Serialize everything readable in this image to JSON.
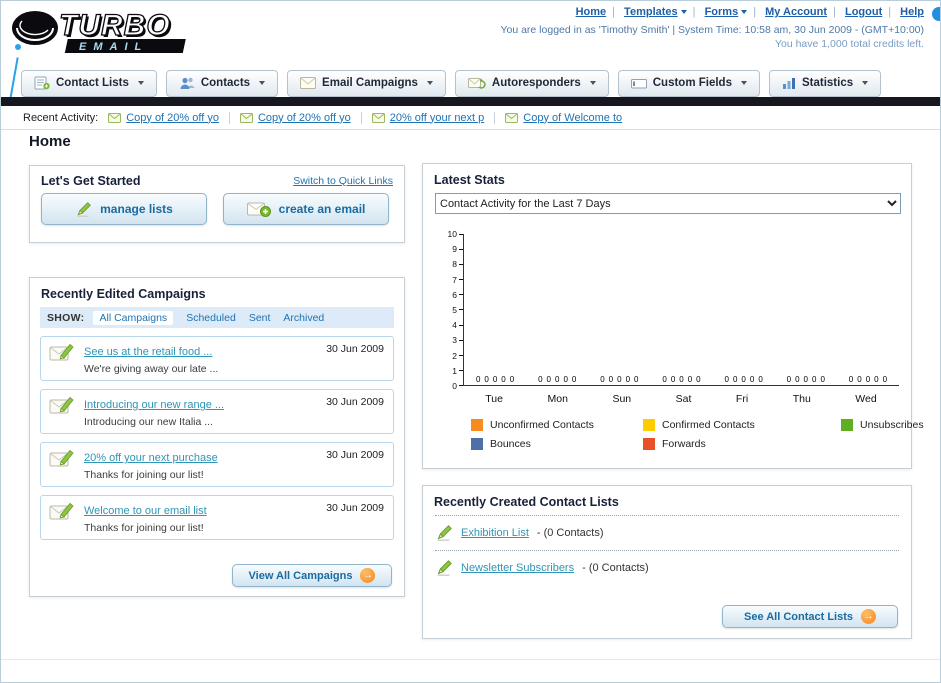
{
  "header": {
    "logo_text": "TURBO",
    "logo_sub": "EMAIL",
    "links": [
      {
        "label": "Home",
        "dropdown": false
      },
      {
        "label": "Templates",
        "dropdown": true
      },
      {
        "label": "Forms",
        "dropdown": true
      },
      {
        "label": "My Account",
        "dropdown": false
      },
      {
        "label": "Logout",
        "dropdown": false
      },
      {
        "label": "Help",
        "dropdown": false
      }
    ],
    "status_line1": "You are logged in as 'Timothy Smith' | System Time: 10:58 am, 30 Jun 2009 - (GMT+10:00)",
    "status_line2": "You have 1,000 total credits left."
  },
  "nav": {
    "items": [
      {
        "label": "Contact Lists"
      },
      {
        "label": "Contacts"
      },
      {
        "label": "Email Campaigns"
      },
      {
        "label": "Autoresponders"
      },
      {
        "label": "Custom Fields"
      },
      {
        "label": "Statistics"
      }
    ]
  },
  "activity": {
    "label": "Recent Activity:",
    "items": [
      "Copy of 20% off yo",
      "Copy of 20% off yo",
      "20% off your next p",
      "Copy of Welcome to"
    ]
  },
  "page_title": "Home",
  "get_started": {
    "title": "Let's Get Started",
    "switch_link": "Switch to Quick Links",
    "manage_button": "manage lists",
    "create_button": "create an email"
  },
  "campaigns": {
    "title": "Recently Edited Campaigns",
    "show_label": "SHOW:",
    "filters": [
      "All Campaigns",
      "Scheduled",
      "Sent",
      "Archived"
    ],
    "items": [
      {
        "title": "See us at the retail food ...",
        "subtitle": "We're giving away our late ...",
        "date": "30 Jun 2009"
      },
      {
        "title": "Introducing our new range ...",
        "subtitle": "Introducing our new Italia ...",
        "date": "30 Jun 2009"
      },
      {
        "title": "20% off your next purchase",
        "subtitle": "Thanks for joining our list!",
        "date": "30 Jun 2009"
      },
      {
        "title": "Welcome to our email list",
        "subtitle": "Thanks for joining our list!",
        "date": "30 Jun 2009"
      }
    ],
    "view_all_label": "View All Campaigns"
  },
  "stats": {
    "title": "Latest Stats",
    "range_value": "Contact Activity for the Last 7 Days",
    "legend": [
      {
        "label": "Unconfirmed Contacts",
        "color": "#F68B1F"
      },
      {
        "label": "Confirmed Contacts",
        "color": "#FFCC00"
      },
      {
        "label": "Unsubscribes",
        "color": "#61AE24"
      },
      {
        "label": "Bounces",
        "color": "#4E6FA8"
      },
      {
        "label": "Forwards",
        "color": "#E8502A"
      }
    ],
    "chart_data": {
      "type": "bar",
      "title": "Contact Activity for the Last 7 Days",
      "categories": [
        "Tue",
        "Mon",
        "Sun",
        "Sat",
        "Fri",
        "Thu",
        "Wed"
      ],
      "series": [
        {
          "name": "Unconfirmed Contacts",
          "color": "#F68B1F",
          "values": [
            0,
            0,
            0,
            0,
            0,
            0,
            0
          ]
        },
        {
          "name": "Confirmed Contacts",
          "color": "#FFCC00",
          "values": [
            0,
            0,
            0,
            0,
            0,
            0,
            0
          ]
        },
        {
          "name": "Unsubscribes",
          "color": "#61AE24",
          "values": [
            0,
            0,
            0,
            0,
            0,
            0,
            0
          ]
        },
        {
          "name": "Bounces",
          "color": "#4E6FA8",
          "values": [
            0,
            0,
            0,
            0,
            0,
            0,
            0
          ]
        },
        {
          "name": "Forwards",
          "color": "#E8502A",
          "values": [
            0,
            0,
            0,
            0,
            0,
            0,
            0
          ]
        }
      ],
      "ylim": [
        0,
        10
      ],
      "grid": false,
      "legend_position": "bottom"
    }
  },
  "contact_lists": {
    "title": "Recently Created Contact Lists",
    "items": [
      {
        "name": "Exhibition List",
        "suffix": "- (0 Contacts)"
      },
      {
        "name": "Newsletter Subscribers",
        "suffix": "- (0 Contacts)"
      }
    ],
    "see_all_label": "See All Contact Lists"
  },
  "colors": {
    "accent_orange": "#F58220",
    "link_blue": "#1D73B4",
    "teal_link": "#2E95B6",
    "dark_bar": "#17171F"
  }
}
